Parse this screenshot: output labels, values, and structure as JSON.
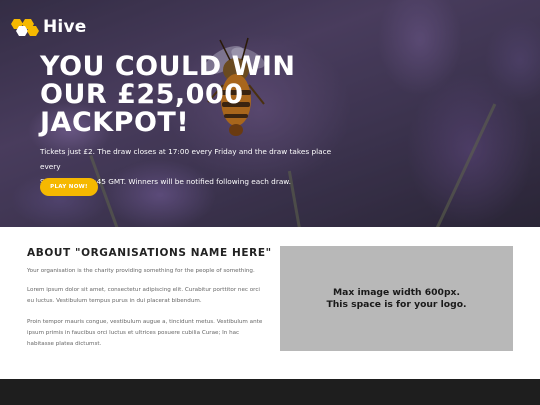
{
  "brand": {
    "name": "Hive",
    "logo_icon": "honeycomb-icon",
    "accent_color": "#f5b800"
  },
  "hero": {
    "title_lines": [
      "YOU COULD WIN",
      "OUR £25,000",
      "JACKPOT!"
    ],
    "text_lines": [
      "Tickets just £2. The draw closes at 17:00 every Friday and the draw takes place every",
      "Saturday at 17:45 GMT. Winners will be notified following each draw."
    ],
    "cta_label": "PLAY NOW!"
  },
  "about": {
    "title": "ABOUT \"ORGANISATIONS NAME HERE\"",
    "paragraphs": [
      [
        "Your organisation is the charity providing something for the people of something."
      ],
      [
        "Lorem ipsum dolor sit amet, consectetur adipiscing elit. Curabitur porttitor nec orci",
        "eu luctus. Vestibulum tempus purus in dui placerat bibendum."
      ],
      [
        "Proin tempor mauris congue, vestibulum augue a, tincidunt metus. Vestibulum ante",
        "ipsum primis in faucibus orci luctus et ultrices posuere cubilia Curae; In hac",
        "habitasse platea dictumst."
      ]
    ],
    "logo_placeholder_lines": [
      "Max image width 600px.",
      "This space is for your logo."
    ]
  }
}
